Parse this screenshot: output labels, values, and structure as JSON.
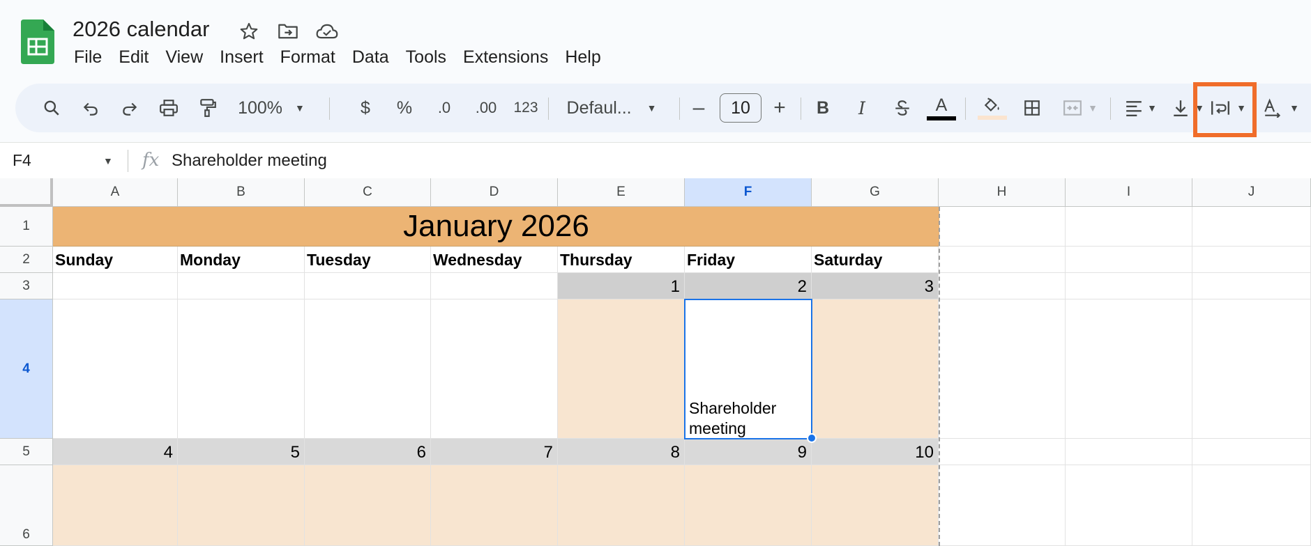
{
  "document": {
    "title": "2026 calendar"
  },
  "title_icons": [
    "star-icon",
    "move-to-folder-icon",
    "cloud-saved-icon"
  ],
  "menu": [
    "File",
    "Edit",
    "View",
    "Insert",
    "Format",
    "Data",
    "Tools",
    "Extensions",
    "Help"
  ],
  "toolbar": {
    "zoom": "100%",
    "currency": "$",
    "percent": "%",
    "decrease_decimal": ".0",
    "increase_decimal": ".00",
    "number_format": "123",
    "font": "Defaul...",
    "font_size": "10",
    "highlighted_button": "text-wrapping"
  },
  "formula_bar": {
    "cell_ref": "F4",
    "fx": "fx",
    "content": "Shareholder meeting"
  },
  "columns": [
    "A",
    "B",
    "C",
    "D",
    "E",
    "F",
    "G",
    "H",
    "I",
    "J"
  ],
  "rows": [
    "1",
    "2",
    "3",
    "4",
    "5",
    "6"
  ],
  "selected": {
    "column": "F",
    "row": "4"
  },
  "calendar": {
    "title": "January 2026",
    "days": [
      "Sunday",
      "Monday",
      "Tuesday",
      "Wednesday",
      "Thursday",
      "Friday",
      "Saturday"
    ],
    "week1_numbers": [
      "",
      "",
      "",
      "",
      "1",
      "2",
      "3"
    ],
    "week2_numbers": [
      "4",
      "5",
      "6",
      "7",
      "8",
      "9",
      "10"
    ],
    "event": {
      "line1": "Shareholder",
      "line2": "meeting"
    }
  },
  "colors": {
    "title_fill": "#ecb474",
    "day_fill": "#f8e5d0",
    "date_fill": "#cfcfcf",
    "selection": "#1a73e8",
    "highlight_box": "#f06d2a"
  }
}
